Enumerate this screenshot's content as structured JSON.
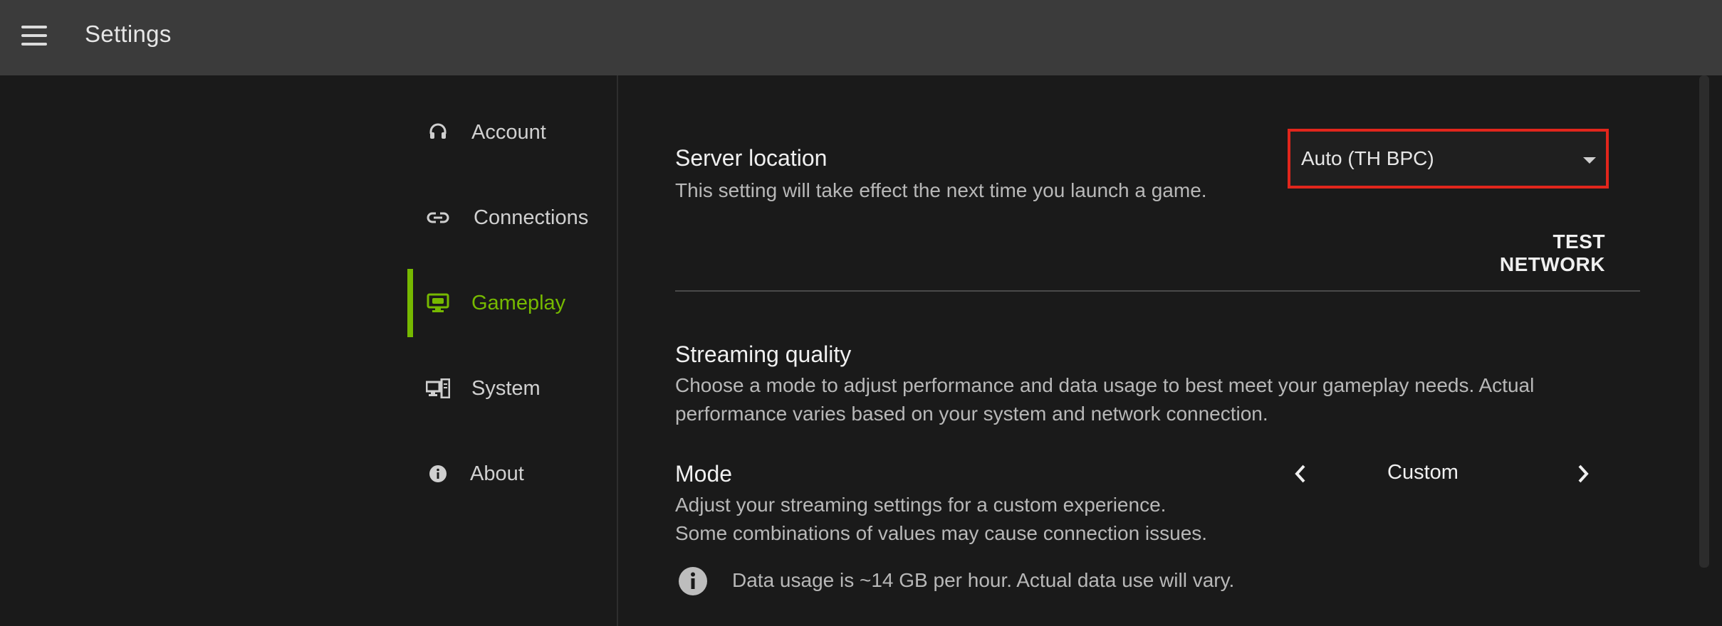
{
  "header": {
    "title": "Settings",
    "menu_icon": "hamburger-menu-icon"
  },
  "sidebar": {
    "items": [
      {
        "label": "Account",
        "icon": "headset-icon",
        "active": false
      },
      {
        "label": "Connections",
        "icon": "link-icon",
        "active": false
      },
      {
        "label": "Gameplay",
        "icon": "monitor-game-icon",
        "active": true
      },
      {
        "label": "System",
        "icon": "computer-system-icon",
        "active": false
      },
      {
        "label": "About",
        "icon": "info-icon",
        "active": false
      }
    ]
  },
  "main": {
    "server_location": {
      "title": "Server location",
      "description": "This setting will take effect the next time you launch a game.",
      "selected": "Auto (TH BPC)",
      "test_network_label": "TEST NETWORK"
    },
    "streaming_quality": {
      "title": "Streaming quality",
      "description_line1": "Choose a mode to adjust performance and data usage to best meet your gameplay needs. Actual",
      "description_line2": "performance varies based on your system and network connection."
    },
    "mode": {
      "title": "Mode",
      "description_line1": "Adjust your streaming settings for a custom experience.",
      "description_line2": "Some combinations of values may cause connection issues.",
      "value": "Custom"
    },
    "data_usage_note": "Data usage is ~14 GB per hour. Actual data use will vary."
  },
  "colors": {
    "accent": "#76b900",
    "highlight_border": "#e1261c",
    "topbar": "#3b3b3b",
    "background": "#1a1a1a"
  }
}
